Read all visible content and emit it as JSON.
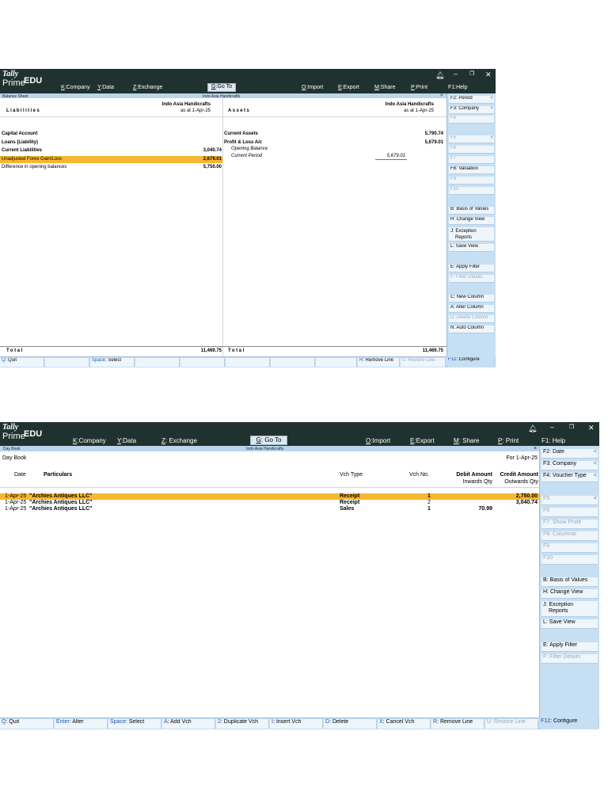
{
  "balance_sheet_window": {
    "logo": {
      "tally": "Tally",
      "prime": "Prime",
      "edu": "EDU"
    },
    "menu": {
      "company": {
        "key": "K",
        "label": ":Company"
      },
      "data": {
        "key": "Y",
        "label": ":Data"
      },
      "exchange": {
        "key": "Z",
        "label": ":Exchange"
      },
      "goto": {
        "key": "G",
        "label": ":Go To"
      },
      "import": {
        "key": "O",
        "label": ":Import"
      },
      "export": {
        "key": "E",
        "label": ":Export"
      },
      "share": {
        "key": "M",
        "label": ":Share"
      },
      "print": {
        "key": "P",
        "label": ":Print"
      },
      "help": "F1:Help"
    },
    "subbar": {
      "left": "Balance Sheet",
      "center": "Indo Asia Handicrafts",
      "close": "×"
    },
    "liabilities": {
      "company": "Indo Asia Handicrafts",
      "as_at": "as at 1-Apr-25",
      "heading": "Liabilities",
      "rows": [
        {
          "name": "Capital Account",
          "amount": ""
        },
        {
          "name": "Loans (Liability)",
          "amount": ""
        },
        {
          "name": "Current Liabilities",
          "amount": "3,040.74"
        },
        {
          "name": "Unadjusted Forex Gain/Loss",
          "amount": "2,679.01"
        },
        {
          "name": "Difference in opening balances",
          "amount": "5,750.00"
        }
      ],
      "total_label": "Total",
      "total": "11,469.75"
    },
    "assets": {
      "company": "Indo Asia Handicrafts",
      "as_at": "as at 1-Apr-25",
      "heading": "Assets",
      "current_assets": {
        "name": "Current Assets",
        "amount": "5,790.74"
      },
      "profit_loss": {
        "name": "Profit & Loss A/c",
        "amount": "5,679.01"
      },
      "opening_balance": "Opening Balance",
      "current_period": {
        "name": "Current Period",
        "amount": "5,679.01"
      },
      "total_label": "Total",
      "total": "11,469.75"
    },
    "right_panel": [
      {
        "label": "F2: Period",
        "disabled": false,
        "arrow": "<"
      },
      {
        "label": "F3: Company",
        "disabled": false,
        "arrow": "<"
      },
      {
        "label": "F4",
        "disabled": true,
        "arrow": ""
      },
      {
        "label": "F5",
        "disabled": true,
        "arrow": "<"
      },
      {
        "label": "F6",
        "disabled": true,
        "arrow": ""
      },
      {
        "label": "F7",
        "disabled": true,
        "arrow": ""
      },
      {
        "label": "F8: Valuation",
        "disabled": false,
        "arrow": ""
      },
      {
        "label": "F9",
        "disabled": true,
        "arrow": ""
      },
      {
        "label": "F10",
        "disabled": true,
        "arrow": ""
      },
      {
        "label": "B: Basis of Values",
        "disabled": false,
        "arrow": ""
      },
      {
        "label": "H: Change View",
        "disabled": false,
        "arrow": ""
      },
      {
        "label": "J: Exception",
        "label2": "Reports",
        "disabled": false,
        "arrow": ""
      },
      {
        "label": "L: Save View",
        "disabled": false,
        "arrow": ""
      },
      {
        "label": "E: Apply Filter",
        "disabled": false,
        "arrow": ""
      },
      {
        "label": "F: Filter Details",
        "disabled": true,
        "arrow": ""
      },
      {
        "label": "C: New Column",
        "disabled": false,
        "arrow": ""
      },
      {
        "label": "A: Alter Column",
        "disabled": false,
        "arrow": ""
      },
      {
        "label": "D: Delete Column",
        "disabled": true,
        "arrow": ""
      },
      {
        "label": "N: Auto Column",
        "disabled": false,
        "arrow": ""
      }
    ],
    "bottom_bar": [
      {
        "key": "Q",
        "label": ": Quit",
        "disabled": false
      },
      {
        "key": "Space",
        "label": ": Select",
        "disabled": false
      },
      {
        "key": "R",
        "label": ": Remove Line",
        "disabled": false
      },
      {
        "key": "U",
        "label": ": Restore Line",
        "disabled": true
      },
      {
        "key": "F12",
        "label": ": Configure",
        "disabled": false
      }
    ]
  },
  "day_book_window": {
    "logo": {
      "tally": "Tally",
      "prime": "Prime",
      "edu": "EDU"
    },
    "menu": {
      "company": {
        "key": "K",
        "label": ":Company"
      },
      "data": {
        "key": "Y",
        "label": ":Data"
      },
      "exchange": {
        "key": "Z",
        "label": ": Exchange"
      },
      "goto": {
        "key": "G",
        "label": ": Go To"
      },
      "import": {
        "key": "O",
        "label": ":Import"
      },
      "export": {
        "key": "E",
        "label": ":Export"
      },
      "share": {
        "key": "M",
        "label": ": Share"
      },
      "print": {
        "key": "P",
        "label": ": Print"
      },
      "help": "F1: Help"
    },
    "subbar": {
      "left": "Day Book",
      "center": "Indo Asia Handicrafts",
      "close": "×"
    },
    "title": "Day Book",
    "period": "For 1-Apr-25",
    "columns": {
      "date": "Date",
      "particulars": "Particulars",
      "vch_type": "Vch Type",
      "vch_no": "Vch No.",
      "debit": "Debit Amount",
      "debit_sub": "Inwards Qty",
      "credit": "Credit Amount",
      "credit_sub": "Outwards Qty"
    },
    "rows": [
      {
        "date": "1-Apr-25",
        "particulars": "\"Archies Antiques LLC\"",
        "vch_type": "Receipt",
        "vch_no": "1",
        "debit": "",
        "credit": "2,750.00"
      },
      {
        "date": "1-Apr-25",
        "particulars": "\"Archies Antiques LLC\"",
        "vch_type": "Receipt",
        "vch_no": "2",
        "debit": "",
        "credit": "3,040.74"
      },
      {
        "date": "1-Apr-25",
        "particulars": "\"Archies Antiques LLC\"",
        "vch_type": "Sales",
        "vch_no": "1",
        "debit": "70.99",
        "credit": ""
      }
    ],
    "right_panel": [
      {
        "label": "F2: Date",
        "disabled": false,
        "arrow": "<"
      },
      {
        "label": "F3: Company",
        "disabled": false,
        "arrow": "<"
      },
      {
        "label": "F4: Voucher Type",
        "disabled": false,
        "arrow": "<"
      },
      {
        "label": "F5",
        "disabled": true,
        "arrow": "<"
      },
      {
        "label": "F6",
        "disabled": true,
        "arrow": ""
      },
      {
        "label": "F7: Show Profit",
        "disabled": true,
        "arrow": ""
      },
      {
        "label": "F8: Columnar",
        "disabled": true,
        "arrow": ""
      },
      {
        "label": "F9",
        "disabled": true,
        "arrow": ""
      },
      {
        "label": "F10",
        "disabled": true,
        "arrow": ""
      },
      {
        "label": "B: Basis of Values",
        "disabled": false,
        "arrow": ""
      },
      {
        "label": "H: Change View",
        "disabled": false,
        "arrow": ""
      },
      {
        "label": "J: Exception",
        "label2": "Reports",
        "disabled": false,
        "arrow": ""
      },
      {
        "label": "L: Save View",
        "disabled": false,
        "arrow": ""
      },
      {
        "label": "E: Apply Filter",
        "disabled": false,
        "arrow": ""
      },
      {
        "label": "F: Filter Details",
        "disabled": true,
        "arrow": ""
      }
    ],
    "bottom_bar": [
      {
        "key": "Q",
        "label": ": Quit",
        "disabled": false
      },
      {
        "key": "Enter",
        "label": ": Alter",
        "disabled": false
      },
      {
        "key": "Space",
        "label": ": Select",
        "disabled": false
      },
      {
        "key": "A",
        "label": ": Add Vch",
        "disabled": false
      },
      {
        "key": "2",
        "label": ": Duplicate Vch",
        "disabled": false
      },
      {
        "key": "I",
        "label": ": Insert Vch",
        "disabled": false
      },
      {
        "key": "D",
        "label": ": Delete",
        "disabled": false
      },
      {
        "key": "X",
        "label": ": Cancel Vch",
        "disabled": false
      },
      {
        "key": "R",
        "label": ": Remove Line",
        "disabled": false
      },
      {
        "key": "U",
        "label": ": Restore Line",
        "disabled": true
      },
      {
        "key": "F12",
        "label": ": Configure",
        "disabled": false
      }
    ]
  }
}
